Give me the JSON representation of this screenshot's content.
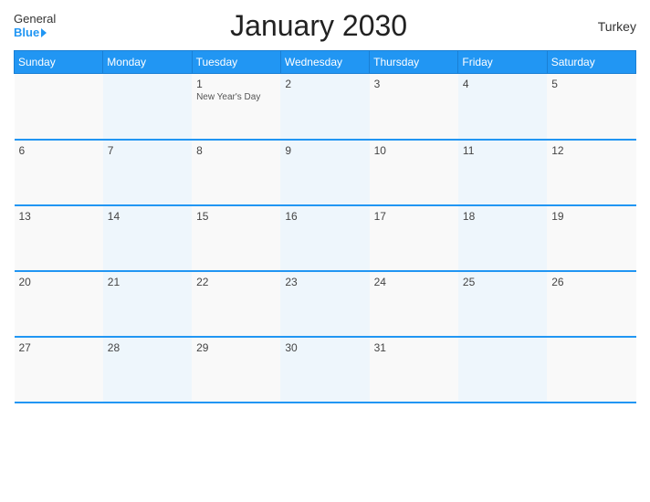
{
  "header": {
    "logo_general": "General",
    "logo_blue": "Blue",
    "title": "January 2030",
    "country": "Turkey"
  },
  "days_of_week": [
    "Sunday",
    "Monday",
    "Tuesday",
    "Wednesday",
    "Thursday",
    "Friday",
    "Saturday"
  ],
  "weeks": [
    [
      {
        "day": "",
        "event": ""
      },
      {
        "day": "",
        "event": ""
      },
      {
        "day": "1",
        "event": "New Year's Day"
      },
      {
        "day": "2",
        "event": ""
      },
      {
        "day": "3",
        "event": ""
      },
      {
        "day": "4",
        "event": ""
      },
      {
        "day": "5",
        "event": ""
      }
    ],
    [
      {
        "day": "6",
        "event": ""
      },
      {
        "day": "7",
        "event": ""
      },
      {
        "day": "8",
        "event": ""
      },
      {
        "day": "9",
        "event": ""
      },
      {
        "day": "10",
        "event": ""
      },
      {
        "day": "11",
        "event": ""
      },
      {
        "day": "12",
        "event": ""
      }
    ],
    [
      {
        "day": "13",
        "event": ""
      },
      {
        "day": "14",
        "event": ""
      },
      {
        "day": "15",
        "event": ""
      },
      {
        "day": "16",
        "event": ""
      },
      {
        "day": "17",
        "event": ""
      },
      {
        "day": "18",
        "event": ""
      },
      {
        "day": "19",
        "event": ""
      }
    ],
    [
      {
        "day": "20",
        "event": ""
      },
      {
        "day": "21",
        "event": ""
      },
      {
        "day": "22",
        "event": ""
      },
      {
        "day": "23",
        "event": ""
      },
      {
        "day": "24",
        "event": ""
      },
      {
        "day": "25",
        "event": ""
      },
      {
        "day": "26",
        "event": ""
      }
    ],
    [
      {
        "day": "27",
        "event": ""
      },
      {
        "day": "28",
        "event": ""
      },
      {
        "day": "29",
        "event": ""
      },
      {
        "day": "30",
        "event": ""
      },
      {
        "day": "31",
        "event": ""
      },
      {
        "day": "",
        "event": ""
      },
      {
        "day": "",
        "event": ""
      }
    ]
  ]
}
